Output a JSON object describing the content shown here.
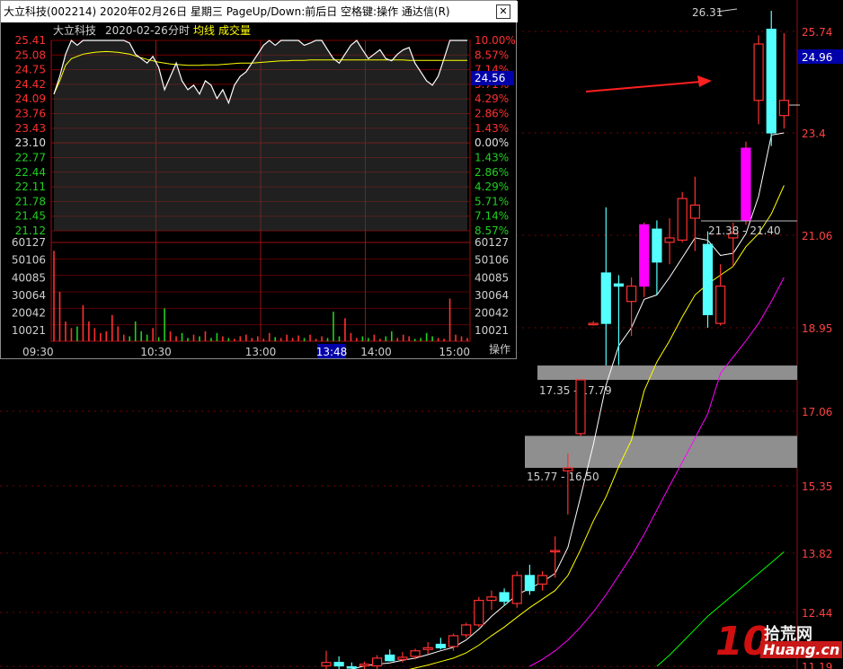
{
  "colors": {
    "up": "#ff3030",
    "down": "#54ffff",
    "up_fill": "#ff00ff",
    "ma5": "#ffffff",
    "ma10": "#ffff00",
    "ma20": "#ff00ff",
    "ma60": "#00ff00",
    "price_tag_bg": "#0000aa"
  },
  "chart_data": [
    {
      "type": "candlestick",
      "title": "",
      "y_ticks": [
        25.74,
        23.4,
        21.06,
        18.95,
        17.06,
        15.35,
        13.82,
        12.44,
        11.19
      ],
      "ylim": [
        11.19,
        26.31
      ],
      "current_price_tag": "24.96",
      "high_label": "26.31",
      "gap_zones": [
        {
          "label": "17.35 - 17.79",
          "low": 17.35,
          "high": 17.79
        },
        {
          "label": "15.77 - 16.50",
          "low": 15.77,
          "high": 16.5
        }
      ],
      "annotation_label": "21.38 - 21.40",
      "candles": [
        {
          "o": 11.2,
          "h": 11.55,
          "l": 11.1,
          "c": 11.28
        },
        {
          "o": 11.28,
          "h": 11.42,
          "l": 11.12,
          "c": 11.2
        },
        {
          "o": 11.18,
          "h": 11.28,
          "l": 11.06,
          "c": 11.15
        },
        {
          "o": 11.2,
          "h": 11.3,
          "l": 11.1,
          "c": 11.24
        },
        {
          "o": 11.2,
          "h": 11.45,
          "l": 11.12,
          "c": 11.38
        },
        {
          "o": 11.45,
          "h": 11.58,
          "l": 11.3,
          "c": 11.32
        },
        {
          "o": 11.35,
          "h": 11.52,
          "l": 11.28,
          "c": 11.4
        },
        {
          "o": 11.42,
          "h": 11.6,
          "l": 11.35,
          "c": 11.55
        },
        {
          "o": 11.58,
          "h": 11.75,
          "l": 11.48,
          "c": 11.62
        },
        {
          "o": 11.7,
          "h": 11.85,
          "l": 11.58,
          "c": 11.62
        },
        {
          "o": 11.65,
          "h": 11.95,
          "l": 11.55,
          "c": 11.9
        },
        {
          "o": 11.92,
          "h": 12.2,
          "l": 11.85,
          "c": 12.15
        },
        {
          "o": 12.15,
          "h": 12.8,
          "l": 12.1,
          "c": 12.72
        },
        {
          "o": 12.72,
          "h": 12.95,
          "l": 12.5,
          "c": 12.8
        },
        {
          "o": 12.9,
          "h": 13.0,
          "l": 12.6,
          "c": 12.7
        },
        {
          "o": 12.65,
          "h": 13.4,
          "l": 12.55,
          "c": 13.3
        },
        {
          "o": 13.3,
          "h": 13.55,
          "l": 12.85,
          "c": 12.95
        },
        {
          "o": 13.1,
          "h": 13.4,
          "l": 12.95,
          "c": 13.3
        },
        {
          "o": 13.85,
          "h": 14.2,
          "l": 13.25,
          "c": 13.88
        },
        {
          "o": 15.7,
          "h": 16.1,
          "l": 14.7,
          "c": 15.77
        },
        {
          "o": 16.55,
          "h": 17.35,
          "l": 16.5,
          "c": 17.35
        },
        {
          "o": 19.05,
          "h": 19.1,
          "l": 19.0,
          "c": 19.05
        },
        {
          "o": 20.2,
          "h": 21.7,
          "l": 17.79,
          "c": 19.05
        },
        {
          "o": 19.95,
          "h": 20.15,
          "l": 17.8,
          "c": 19.9
        },
        {
          "o": 19.55,
          "h": 20.1,
          "l": 18.7,
          "c": 19.9
        },
        {
          "o": 19.9,
          "h": 21.35,
          "l": 19.65,
          "c": 21.3
        },
        {
          "o": 21.2,
          "h": 21.4,
          "l": 19.7,
          "c": 20.45
        },
        {
          "o": 20.9,
          "h": 21.45,
          "l": 20.4,
          "c": 21.0
        },
        {
          "o": 20.95,
          "h": 22.05,
          "l": 20.9,
          "c": 21.9
        },
        {
          "o": 21.45,
          "h": 22.4,
          "l": 20.7,
          "c": 21.75
        },
        {
          "o": 20.85,
          "h": 21.15,
          "l": 18.95,
          "c": 19.25
        },
        {
          "o": 19.05,
          "h": 20.4,
          "l": 19.0,
          "c": 19.9
        },
        {
          "o": 21.0,
          "h": 21.35,
          "l": 20.35,
          "c": 21.1
        },
        {
          "o": 21.4,
          "h": 23.2,
          "l": 21.3,
          "c": 23.05
        },
        {
          "o": 24.15,
          "h": 25.65,
          "l": 23.6,
          "c": 25.45
        },
        {
          "o": 25.8,
          "h": 26.31,
          "l": 23.1,
          "c": 23.4
        },
        {
          "o": 23.8,
          "h": 25.7,
          "l": 23.5,
          "c": 24.15
        }
      ],
      "ma_series": [
        {
          "key": "ma5",
          "values": [
            10.85,
            11.0,
            11.12,
            11.2,
            11.24,
            11.27,
            11.33,
            11.38,
            11.46,
            11.55,
            11.63,
            11.8,
            12.05,
            12.35,
            12.6,
            12.85,
            13.0,
            13.15,
            13.35,
            13.95,
            15.1,
            16.3,
            17.3,
            18.4,
            18.95,
            19.6,
            19.7,
            20.1,
            20.55,
            21.0,
            20.95,
            20.6,
            20.65,
            21.1,
            21.95,
            23.35,
            23.4
          ]
        },
        {
          "key": "ma10",
          "values": [
            null,
            null,
            null,
            null,
            null,
            11.0,
            11.08,
            11.15,
            11.22,
            11.3,
            11.38,
            11.5,
            11.68,
            11.9,
            12.1,
            12.33,
            12.55,
            12.75,
            12.95,
            13.3,
            13.9,
            14.55,
            15.1,
            15.8,
            16.4,
            17.25,
            17.9,
            18.55,
            19.2,
            19.7,
            19.95,
            20.15,
            20.35,
            20.8,
            21.1,
            21.55,
            22.2
          ]
        },
        {
          "key": "ma20",
          "values": [
            null,
            null,
            null,
            null,
            null,
            null,
            null,
            null,
            null,
            null,
            null,
            null,
            null,
            null,
            null,
            null,
            11.19,
            11.35,
            11.55,
            11.8,
            12.1,
            12.45,
            12.85,
            13.3,
            13.75,
            14.25,
            14.8,
            15.35,
            15.9,
            16.45,
            17.0,
            17.55,
            18.05,
            18.55,
            19.05,
            19.55,
            20.1
          ]
        },
        {
          "key": "ma60",
          "values": [
            null,
            null,
            null,
            null,
            null,
            null,
            null,
            null,
            null,
            null,
            null,
            null,
            null,
            null,
            null,
            null,
            null,
            null,
            null,
            null,
            null,
            null,
            null,
            null,
            null,
            null,
            11.19,
            11.45,
            11.75,
            12.05,
            12.35,
            12.6,
            12.85,
            13.1,
            13.35,
            13.6,
            13.85
          ]
        }
      ]
    },
    {
      "type": "line",
      "title": "大立科技",
      "date": "2020-02-26",
      "mode": "分时",
      "legend": [
        "均线",
        "成交量"
      ],
      "x_ticks": [
        "09:30",
        "10:30",
        "13:00",
        "14:00",
        "15:00"
      ],
      "cursor_time": "13:48",
      "prev_close": 23.1,
      "left_ticks": [
        {
          "v": "25.41",
          "c": "up"
        },
        {
          "v": "25.08",
          "c": "up"
        },
        {
          "v": "24.75",
          "c": "up"
        },
        {
          "v": "24.42",
          "c": "up"
        },
        {
          "v": "24.09",
          "c": "up"
        },
        {
          "v": "23.76",
          "c": "up"
        },
        {
          "v": "23.43",
          "c": "up"
        },
        {
          "v": "23.10",
          "c": "flat"
        },
        {
          "v": "22.77",
          "c": "dn"
        },
        {
          "v": "22.44",
          "c": "dn"
        },
        {
          "v": "22.11",
          "c": "dn"
        },
        {
          "v": "21.78",
          "c": "dn"
        },
        {
          "v": "21.45",
          "c": "dn"
        },
        {
          "v": "21.12",
          "c": "dn"
        }
      ],
      "right_ticks": [
        {
          "v": "10.00%",
          "c": "up"
        },
        {
          "v": "8.57%",
          "c": "up"
        },
        {
          "v": "7.14%",
          "c": "up"
        },
        {
          "v": "5.71%",
          "c": "up"
        },
        {
          "v": "4.29%",
          "c": "up"
        },
        {
          "v": "2.86%",
          "c": "up"
        },
        {
          "v": "1.43%",
          "c": "up"
        },
        {
          "v": "0.00%",
          "c": "flat"
        },
        {
          "v": "1.43%",
          "c": "dn"
        },
        {
          "v": "2.86%",
          "c": "dn"
        },
        {
          "v": "4.29%",
          "c": "dn"
        },
        {
          "v": "5.71%",
          "c": "dn"
        },
        {
          "v": "7.14%",
          "c": "dn"
        },
        {
          "v": "8.57%",
          "c": "dn"
        }
      ],
      "cursor_price": "24.56",
      "volume_ticks": [
        "60127",
        "50106",
        "40085",
        "30064",
        "20042",
        "10021"
      ],
      "price_series": [
        24.2,
        24.6,
        25.1,
        25.41,
        25.3,
        25.41,
        25.41,
        25.41,
        25.41,
        25.41,
        25.41,
        25.41,
        25.41,
        25.35,
        25.1,
        25.0,
        24.9,
        25.05,
        24.8,
        24.3,
        24.6,
        24.9,
        24.5,
        24.3,
        24.4,
        24.2,
        24.5,
        24.4,
        24.1,
        24.3,
        24.0,
        24.4,
        24.6,
        24.7,
        24.9,
        25.1,
        25.3,
        25.41,
        25.3,
        25.41,
        25.41,
        25.41,
        25.41,
        25.3,
        25.35,
        25.41,
        25.41,
        25.2,
        25.0,
        24.9,
        25.1,
        25.3,
        25.41,
        25.2,
        25.0,
        25.1,
        25.2,
        25.0,
        24.95,
        25.1,
        25.2,
        25.25,
        24.9,
        24.7,
        24.5,
        24.4,
        24.6,
        25.0,
        25.41,
        25.41,
        25.41,
        25.41
      ],
      "avg_series": [
        24.2,
        24.5,
        24.85,
        25.0,
        25.05,
        25.1,
        25.12,
        25.14,
        25.15,
        25.16,
        25.15,
        25.14,
        25.12,
        25.1,
        25.06,
        25.02,
        24.98,
        24.95,
        24.92,
        24.9,
        24.88,
        24.87,
        24.86,
        24.85,
        24.85,
        24.85,
        24.86,
        24.86,
        24.86,
        24.87,
        24.88,
        24.89,
        24.9,
        24.9,
        24.9,
        24.91,
        24.92,
        24.93,
        24.94,
        24.95,
        24.95,
        24.96,
        24.96,
        24.96,
        24.97,
        24.97,
        24.97,
        24.97,
        24.97,
        24.97,
        24.97,
        24.97,
        24.97,
        24.97,
        24.97,
        24.97,
        24.97,
        24.97,
        24.97,
        24.97,
        24.97,
        24.96,
        24.96,
        24.96,
        24.96,
        24.96,
        24.96,
        24.96,
        24.96,
        24.96,
        24.96,
        24.96
      ],
      "volume_series": [
        55000,
        30000,
        12000,
        8000,
        9000,
        22000,
        12000,
        8000,
        5000,
        6000,
        16000,
        9000,
        4000,
        3000,
        12000,
        6000,
        4000,
        8000,
        2500,
        20000,
        6000,
        3000,
        5000,
        2000,
        4000,
        3000,
        6000,
        2000,
        5000,
        3000,
        2000,
        1500,
        3000,
        4000,
        2000,
        3000,
        1500,
        5000,
        2500,
        2000,
        4000,
        2000,
        3500,
        2000,
        4000,
        1500,
        3000,
        2000,
        18000,
        3000,
        14000,
        5000,
        2000,
        3000,
        2000,
        4000,
        1500,
        3000,
        6000,
        2000,
        4000,
        3000,
        1500,
        2000,
        5000,
        3000,
        2000,
        1500,
        26000,
        4000,
        3000,
        2000
      ]
    }
  ],
  "popup": {
    "title": "大立科技(002214)  2020年02月26日  星期三  PageUp/Down:前后日  空格键:操作  通达信(R)",
    "close_label": "✕",
    "op_label": "操作"
  },
  "watermark": {
    "logo": "10",
    "cn": "拾荒网",
    "url": "Huang.cn"
  }
}
